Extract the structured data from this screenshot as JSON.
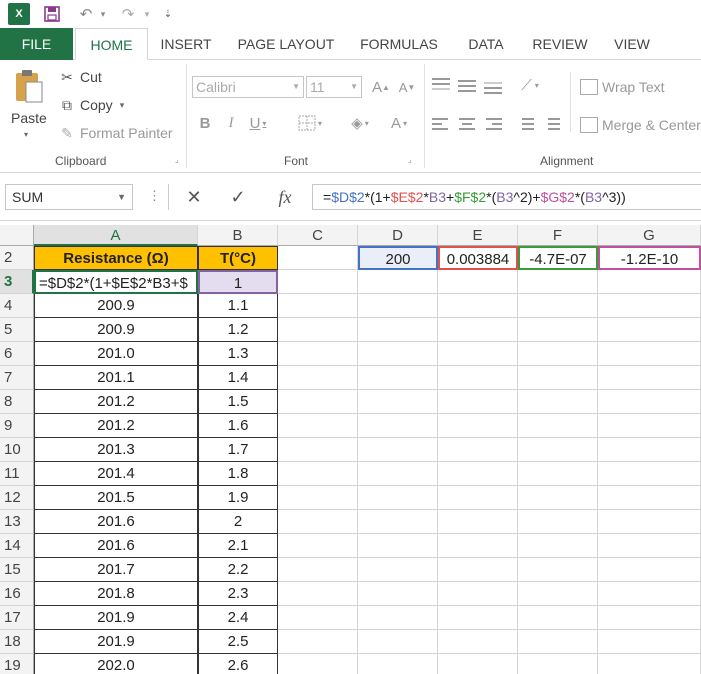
{
  "app": {
    "logo": "X"
  },
  "ribbon_tabs": [
    "FILE",
    "HOME",
    "INSERT",
    "PAGE LAYOUT",
    "FORMULAS",
    "DATA",
    "REVIEW",
    "VIEW"
  ],
  "clipboard": {
    "paste": "Paste",
    "cut": "Cut",
    "copy": "Copy",
    "format_painter": "Format Painter",
    "group_label": "Clipboard"
  },
  "font": {
    "name": "Calibri",
    "size": "11",
    "group_label": "Font"
  },
  "alignment": {
    "wrap_text": "Wrap Text",
    "merge_center": "Merge & Center",
    "group_label": "Alignment"
  },
  "formula_bar": {
    "name_box": "SUM",
    "cancel": "✕",
    "enter": "✓",
    "fx": "fx",
    "formula_parts": [
      {
        "text": "=",
        "color": "#222222"
      },
      {
        "text": "$D$2",
        "color": "#4472c4"
      },
      {
        "text": "*(1+",
        "color": "#222222"
      },
      {
        "text": "$E$2",
        "color": "#e0504f"
      },
      {
        "text": "*",
        "color": "#222222"
      },
      {
        "text": "B3",
        "color": "#8064a2"
      },
      {
        "text": "+",
        "color": "#222222"
      },
      {
        "text": "$F$2",
        "color": "#3a9a3a"
      },
      {
        "text": "*(",
        "color": "#222222"
      },
      {
        "text": "B3",
        "color": "#8064a2"
      },
      {
        "text": "^2)+",
        "color": "#222222"
      },
      {
        "text": "$G$2",
        "color": "#c0509b"
      },
      {
        "text": "*(",
        "color": "#222222"
      },
      {
        "text": "B3",
        "color": "#8064a2"
      },
      {
        "text": "^3))",
        "color": "#222222"
      }
    ]
  },
  "grid": {
    "columns": [
      "A",
      "B",
      "C",
      "D",
      "E",
      "F",
      "G"
    ],
    "header_row": {
      "row": "2",
      "A": "Resistance (Ω)",
      "B": "T(°C)"
    },
    "constants": {
      "D2": "200",
      "E2": "0.003884",
      "F2": "-4.7E-07",
      "G2": "-1.2E-10"
    },
    "edit_cell": {
      "row": "3",
      "A": "=$D$2*(1+$E$2*B3+$",
      "B": "1"
    },
    "rows": [
      {
        "row": "4",
        "A": "200.9",
        "B": "1.1"
      },
      {
        "row": "5",
        "A": "200.9",
        "B": "1.2"
      },
      {
        "row": "6",
        "A": "201.0",
        "B": "1.3"
      },
      {
        "row": "7",
        "A": "201.1",
        "B": "1.4"
      },
      {
        "row": "8",
        "A": "201.2",
        "B": "1.5"
      },
      {
        "row": "9",
        "A": "201.2",
        "B": "1.6"
      },
      {
        "row": "10",
        "A": "201.3",
        "B": "1.7"
      },
      {
        "row": "11",
        "A": "201.4",
        "B": "1.8"
      },
      {
        "row": "12",
        "A": "201.5",
        "B": "1.9"
      },
      {
        "row": "13",
        "A": "201.6",
        "B": "2"
      },
      {
        "row": "14",
        "A": "201.6",
        "B": "2.1"
      },
      {
        "row": "15",
        "A": "201.7",
        "B": "2.2"
      },
      {
        "row": "16",
        "A": "201.8",
        "B": "2.3"
      },
      {
        "row": "17",
        "A": "201.9",
        "B": "2.4"
      },
      {
        "row": "18",
        "A": "201.9",
        "B": "2.5"
      },
      {
        "row": "19",
        "A": "202.0",
        "B": "2.6"
      }
    ]
  },
  "colors": {
    "brand": "#217346",
    "header_fill": "#ffc000",
    "ref_d": "#4472c4",
    "ref_e": "#e0504f",
    "ref_f": "#3a9a3a",
    "ref_g": "#c0509b",
    "ref_b": "#8064a2"
  }
}
